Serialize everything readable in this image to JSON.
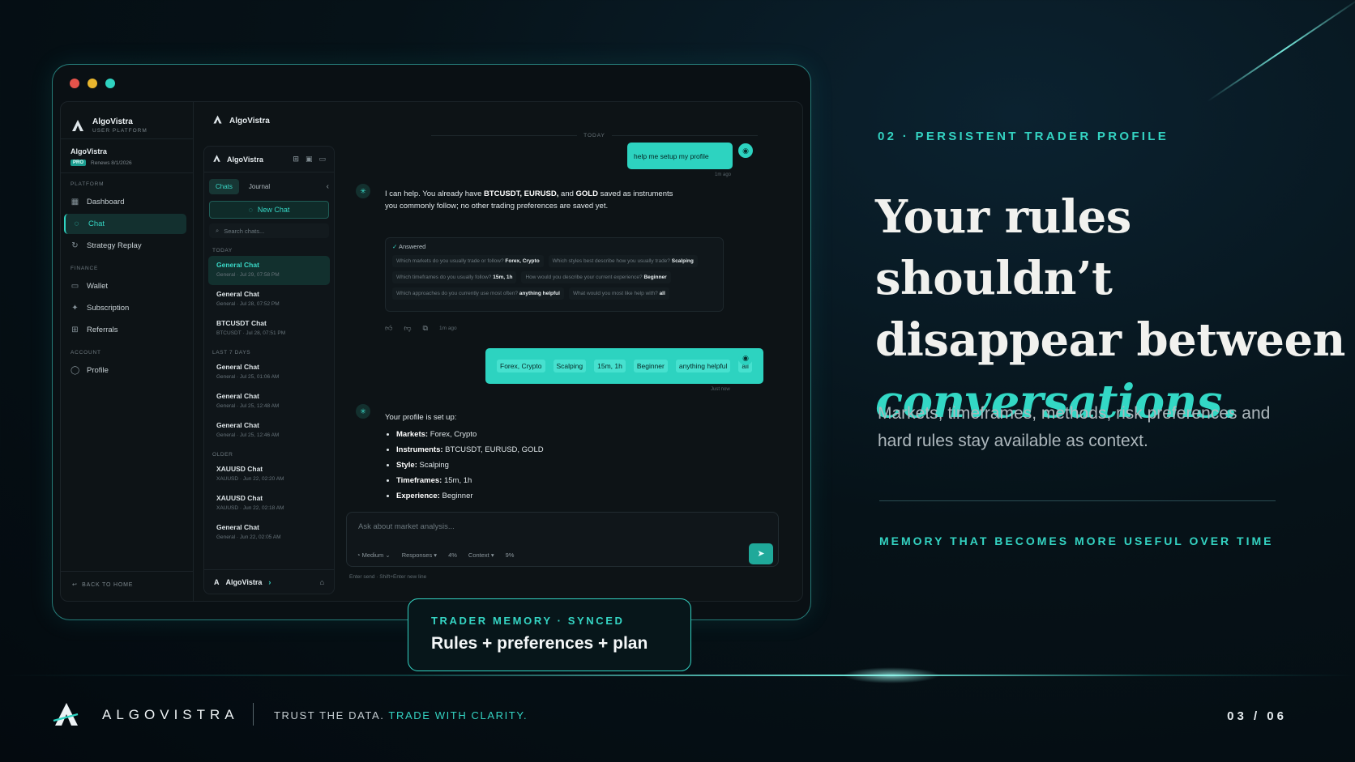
{
  "window": {
    "traffic_colors": [
      "#e5534b",
      "#e9b62e",
      "#2fd3c1"
    ]
  },
  "app": {
    "brand_name": "AlgoVistra",
    "brand_sub": "USER PLATFORM",
    "account_name": "AlgoVistra",
    "plan_badge": "PRO",
    "renews": "Renews 8/1/2026",
    "sections": {
      "platform": "PLATFORM",
      "finance": "FINANCE",
      "account": "ACCOUNT"
    },
    "nav": {
      "dashboard": "Dashboard",
      "chat": "Chat",
      "strategy_replay": "Strategy Replay",
      "wallet": "Wallet",
      "subscription": "Subscription",
      "referrals": "Referrals",
      "profile": "Profile"
    },
    "back_home": "BACK TO HOME",
    "topbar_title": "AlgoVistra"
  },
  "chat_list": {
    "header_title": "AlgoVistra",
    "tab_chats": "Chats",
    "tab_journal": "Journal",
    "new_chat": "New Chat",
    "search_placeholder": "Search chats...",
    "group_today": "TODAY",
    "group_last7": "LAST 7 DAYS",
    "group_older": "OLDER",
    "items": [
      {
        "title": "General Chat",
        "sub": "General · Jul 29, 07:58 PM"
      },
      {
        "title": "General Chat",
        "sub": "General · Jul 28, 07:52 PM"
      },
      {
        "title": "BTCUSDT Chat",
        "sub": "BTCUSDT · Jul 28, 07:51 PM"
      },
      {
        "title": "General Chat",
        "sub": "General · Jul 25, 01:06 AM"
      },
      {
        "title": "General Chat",
        "sub": "General · Jul 25, 12:48 AM"
      },
      {
        "title": "General Chat",
        "sub": "General · Jul 25, 12:46 AM"
      },
      {
        "title": "XAUUSD Chat",
        "sub": "XAUUSD · Jun 22, 02:20 AM"
      },
      {
        "title": "XAUUSD Chat",
        "sub": "XAUUSD · Jun 22, 02:18 AM"
      },
      {
        "title": "General Chat",
        "sub": "General · Jun 22, 02:05 AM"
      }
    ],
    "footer_name": "AlgoVistra"
  },
  "conversation": {
    "day_label": "TODAY",
    "user_msg_1": "help me setup my profile",
    "user_msg_1_time": "1m ago",
    "bot_msg_1_a": "I can help. You already have ",
    "bot_msg_1_b": "BTCUSDT, EURUSD,",
    "bot_msg_1_c": " and ",
    "bot_msg_1_d": "GOLD",
    "bot_msg_1_e": " saved as instruments",
    "bot_msg_1_f": "you commonly follow; no other trading preferences are saved yet.",
    "answered_label": "Answered",
    "qa": [
      {
        "q": "Which markets do you usually trade or follow?",
        "a": "Forex, Crypto"
      },
      {
        "q": "Which styles best describe how you usually trade?",
        "a": "Scalping"
      },
      {
        "q": "Which timeframes do you usually follow?",
        "a": "15m, 1h"
      },
      {
        "q": "How would you describe your current experience?",
        "a": "Beginner"
      },
      {
        "q": "Which approaches do you currently use most often?",
        "a": "anything helpful"
      },
      {
        "q": "What would you most like help with?",
        "a": "all"
      }
    ],
    "bot_msg_1_time": "1m ago",
    "user_chips": [
      "Forex, Crypto",
      "Scalping",
      "15m, 1h",
      "Beginner",
      "anything helpful",
      "all"
    ],
    "user_msg_2_time": "Just now",
    "profile_intro": "Your profile is set up:",
    "profile_items": [
      {
        "k": "Markets:",
        "v": " Forex, Crypto"
      },
      {
        "k": "Instruments:",
        "v": " BTCUSDT, EURUSD, GOLD"
      },
      {
        "k": "Style:",
        "v": " Scalping"
      },
      {
        "k": "Timeframes:",
        "v": " 15m, 1h"
      },
      {
        "k": "Experience:",
        "v": " Beginner"
      }
    ],
    "composer_placeholder": "Ask about market analysis...",
    "opt_effort": "Medium",
    "opt_responses": "Responses",
    "opt_responses_pct": "4%",
    "opt_context": "Context",
    "opt_context_pct": "9%",
    "hint": "Enter send · Shift+Enter new line"
  },
  "badge": {
    "kicker": "TRADER MEMORY · SYNCED",
    "value": "Rules + preferences + plan"
  },
  "copy": {
    "eyebrow": "02 · PERSISTENT TRADER PROFILE",
    "headline_1": "Your rules shouldn’t",
    "headline_2": "disappear between",
    "headline_3": "conversations.",
    "lede": "Markets, timeframes, methods, risk preferences and hard rules stay available as context.",
    "tagline": "MEMORY THAT BECOMES MORE USEFUL OVER TIME"
  },
  "footer": {
    "brand": "ALGOVISTRA",
    "tag_a": "TRUST THE DATA.",
    "tag_b": "TRADE WITH CLARITY.",
    "page": "03 / 06"
  },
  "colors": {
    "accent": "#2fd3c1",
    "background": "#061218"
  }
}
